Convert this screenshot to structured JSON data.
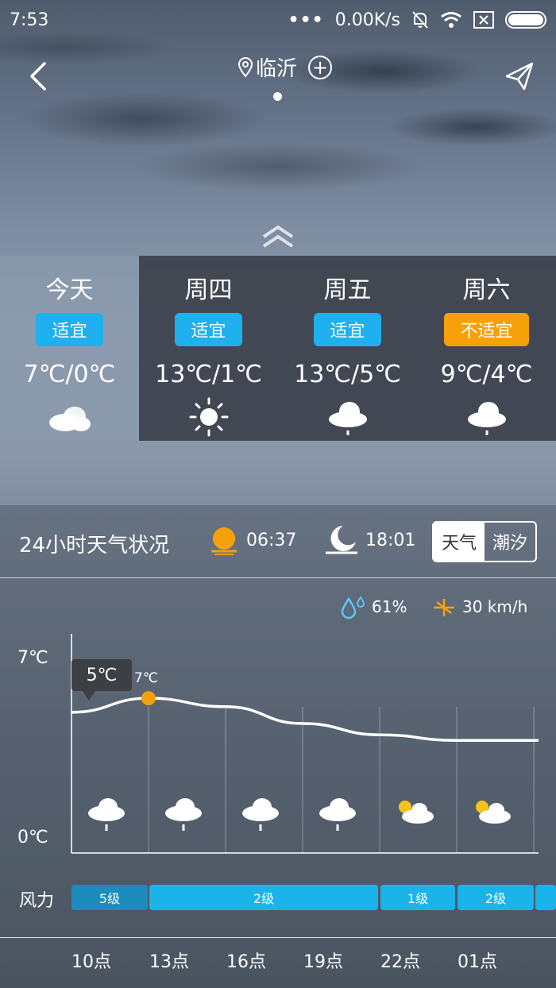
{
  "status": {
    "time": "7:53",
    "dots": "•••",
    "speed": "0.00K/s"
  },
  "header": {
    "city": "临沂",
    "add": "+"
  },
  "forecast": [
    {
      "day": "今天",
      "badge": "适宜",
      "badge_type": "ok",
      "temp": "7℃/0℃",
      "icon": "cloudy-icon"
    },
    {
      "day": "周四",
      "badge": "适宜",
      "badge_type": "ok",
      "temp": "13℃/1℃",
      "icon": "sunny-icon"
    },
    {
      "day": "周五",
      "badge": "适宜",
      "badge_type": "ok",
      "temp": "13℃/5℃",
      "icon": "rain-icon"
    },
    {
      "day": "周六",
      "badge": "不适宜",
      "badge_type": "bad",
      "temp": "9℃/4℃",
      "icon": "rain-icon"
    }
  ],
  "panel": {
    "title": "24小时天气状况",
    "sunrise": "06:37",
    "sunset": "18:01",
    "toggle": {
      "weather": "天气",
      "tide": "潮汐"
    },
    "humidity": "61%",
    "wind": "30 km/h"
  },
  "chart_data": {
    "type": "line",
    "x": [
      "10点",
      "13点",
      "16点",
      "19点",
      "22点",
      "01点"
    ],
    "values": [
      5,
      5.5,
      5.2,
      4.6,
      4.2,
      4.0
    ],
    "ylim": [
      0,
      7
    ],
    "ytick_labels": [
      "7℃",
      "0℃"
    ],
    "tooltip": "5℃",
    "highlight_label": "7℃",
    "icons": [
      "rain-icon",
      "rain-icon",
      "rain-icon",
      "rain-icon",
      "partly-sunny-icon",
      "partly-sunny-icon"
    ]
  },
  "wind_force": {
    "label": "风力",
    "segments": [
      "5级",
      "2级",
      "1级",
      "2级"
    ]
  },
  "hours": [
    "10点",
    "13点",
    "16点",
    "19点",
    "22点",
    "01点"
  ],
  "colors": {
    "accent": "#1fb0ef",
    "warn": "#f7a10a",
    "sun": "#f7a10a"
  }
}
